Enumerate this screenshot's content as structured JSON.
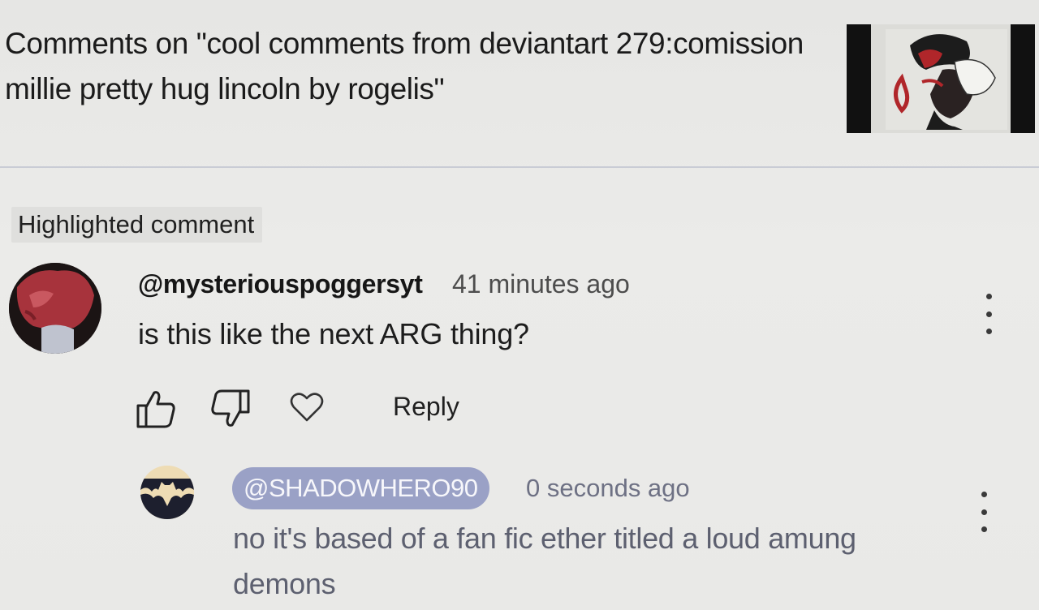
{
  "header": {
    "title": "Comments on \"cool comments from deviantart 279:comission millie pretty hug lincoln by rogelis\""
  },
  "highlighted_label": "Highlighted comment",
  "comment": {
    "author": "@mysteriouspoggersyt",
    "time": "41 minutes ago",
    "text": "is this like the next ARG thing?",
    "reply_label": "Reply"
  },
  "reply": {
    "author": "@SHADOWHERO90",
    "time": "0 seconds ago",
    "text": "no it's based of a fan fic ether titled a loud amung demons"
  },
  "colors": {
    "accent_pill": "#9aa1c6",
    "reply_text": "#5d6070",
    "divider": "#c9ccd5"
  },
  "icons": [
    "like-icon",
    "dislike-icon",
    "heart-icon",
    "more-vert-icon",
    "avatar"
  ]
}
